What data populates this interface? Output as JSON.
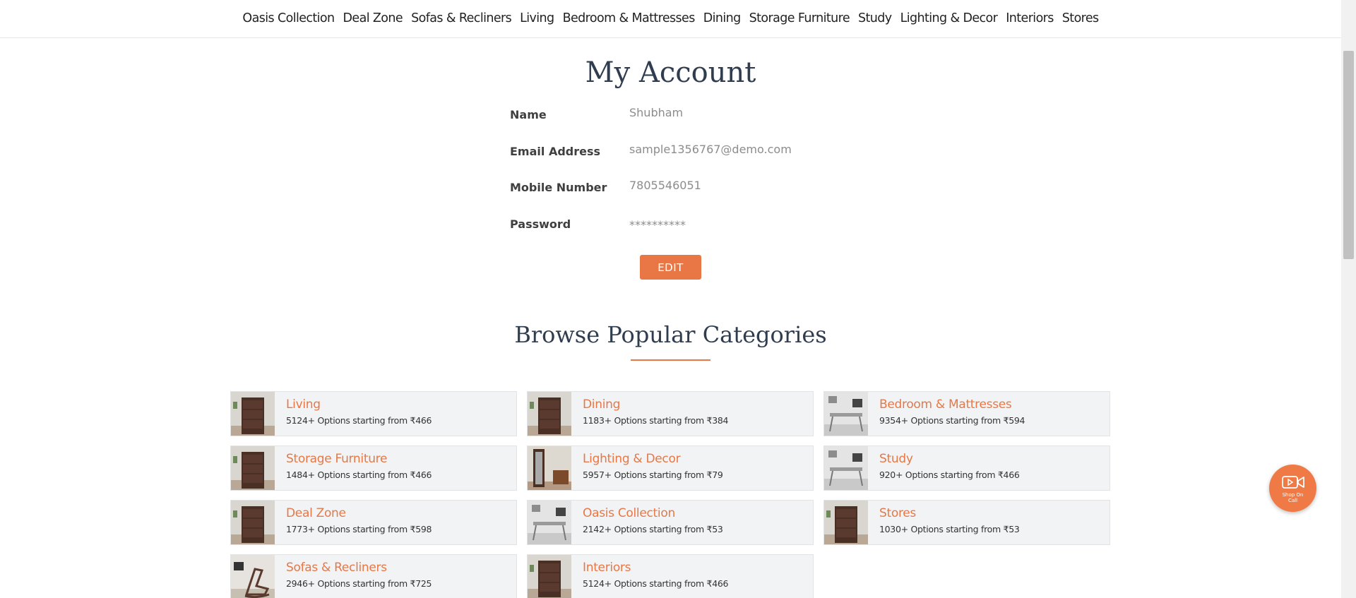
{
  "nav": {
    "items": [
      {
        "label": "Oasis Collection"
      },
      {
        "label": "Deal Zone"
      },
      {
        "label": "Sofas & Recliners"
      },
      {
        "label": "Living"
      },
      {
        "label": "Bedroom & Mattresses"
      },
      {
        "label": "Dining"
      },
      {
        "label": "Storage Furniture"
      },
      {
        "label": "Study"
      },
      {
        "label": "Lighting & Decor"
      },
      {
        "label": "Interiors"
      },
      {
        "label": "Stores"
      }
    ]
  },
  "account": {
    "title": "My Account",
    "fields": [
      {
        "label": "Name",
        "value": "Shubham"
      },
      {
        "label": "Email Address",
        "value": "sample1356767@demo.com"
      },
      {
        "label": "Mobile Number",
        "value": "7805546051"
      },
      {
        "label": "Password",
        "value": "**********"
      }
    ],
    "edit_label": "EDIT"
  },
  "categories": {
    "title": "Browse Popular Categories",
    "items": [
      {
        "name": "Living",
        "desc": "5124+ Options starting from ₹466",
        "thumb": "cabinet"
      },
      {
        "name": "Dining",
        "desc": "1183+ Options starting from ₹384",
        "thumb": "cabinet"
      },
      {
        "name": "Bedroom & Mattresses",
        "desc": "9354+ Options starting from ₹594",
        "thumb": "desk"
      },
      {
        "name": "Storage Furniture",
        "desc": "1484+ Options starting from ₹466",
        "thumb": "cabinet"
      },
      {
        "name": "Lighting & Decor",
        "desc": "5957+ Options starting from ₹79",
        "thumb": "mirror"
      },
      {
        "name": "Study",
        "desc": "920+ Options starting from ₹466",
        "thumb": "desk"
      },
      {
        "name": "Deal Zone",
        "desc": "1773+ Options starting from ₹598",
        "thumb": "cabinet"
      },
      {
        "name": "Oasis Collection",
        "desc": "2142+ Options starting from ₹53",
        "thumb": "desk"
      },
      {
        "name": "Stores",
        "desc": "1030+ Options starting from ₹53",
        "thumb": "cabinet"
      },
      {
        "name": "Sofas & Recliners",
        "desc": "2946+ Options starting from ₹725",
        "thumb": "chair"
      },
      {
        "name": "Interiors",
        "desc": "5124+ Options starting from ₹466",
        "thumb": "cabinet"
      }
    ]
  },
  "shop_on_call": {
    "label": "Shop On Call",
    "icon": "video-camera-icon"
  },
  "colors": {
    "accent": "#e97745",
    "heading": "#2f3d4f",
    "card_bg": "#f1f3f4"
  }
}
